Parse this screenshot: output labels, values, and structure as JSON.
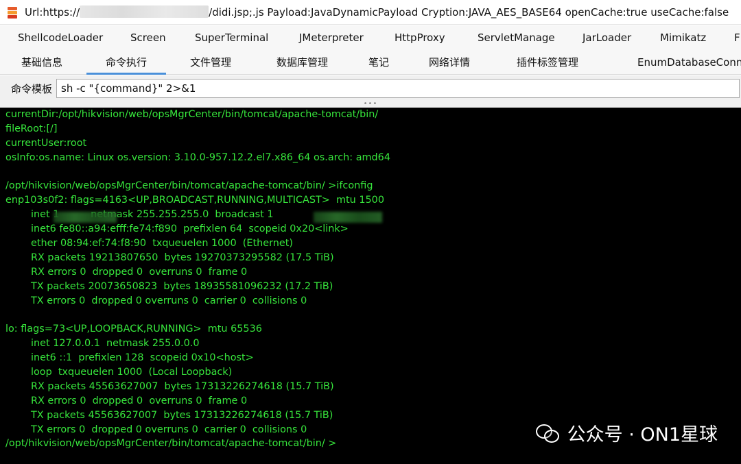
{
  "window": {
    "title_prefix": "Url:https://",
    "title_suffix": "/didi.jsp;.js Payload:JavaDynamicPayload Cryption:JAVA_AES_BASE64 openCache:true useCache:false"
  },
  "tabs_row1": [
    "ShellcodeLoader",
    "Screen",
    "SuperTerminal",
    "JMeterpreter",
    "HttpProxy",
    "ServletManage",
    "JarLoader",
    "Mimikatz",
    "F"
  ],
  "tabs_row2": [
    "基础信息",
    "命令执行",
    "文件管理",
    "数据库管理",
    "笔记",
    "网络详情",
    "插件标签管理",
    "EnumDatabaseConn"
  ],
  "active_tab": "命令执行",
  "command": {
    "label": "命令模板",
    "value": "sh -c \"{command}\" 2>&1"
  },
  "splitter_grip": "•••",
  "console": {
    "lines": [
      "currentDir:/opt/hikvision/web/opsMgrCenter/bin/tomcat/apache-tomcat/bin/",
      "fileRoot:[/]",
      "currentUser:root",
      "osInfo:os.name: Linux os.version: 3.10.0-957.12.2.el7.x86_64 os.arch: amd64",
      "",
      "/opt/hikvision/web/opsMgrCenter/bin/tomcat/apache-tomcat/bin/ >ifconfig",
      "enp103s0f2: flags=4163<UP,BROADCAST,RUNNING,MULTICAST>  mtu 1500",
      "inet 1          netmask 255.255.255.0  broadcast 1",
      "inet6 fe80::a94:efff:fe74:f890  prefixlen 64  scopeid 0x20<link>",
      "ether 08:94:ef:74:f8:90  txqueuelen 1000  (Ethernet)",
      "RX packets 19213807650  bytes 19270373295582 (17.5 TiB)",
      "RX errors 0  dropped 0  overruns 0  frame 0",
      "TX packets 20073650823  bytes 18935581096232 (17.2 TiB)",
      "TX errors 0  dropped 0 overruns 0  carrier 0  collisions 0",
      "",
      "lo: flags=73<UP,LOOPBACK,RUNNING>  mtu 65536",
      "inet 127.0.0.1  netmask 255.0.0.0",
      "inet6 ::1  prefixlen 128  scopeid 0x10<host>",
      "loop  txqueuelen 1000  (Local Loopback)",
      "RX packets 45563627007  bytes 17313226274618 (15.7 TiB)",
      "RX errors 0  dropped 0  overruns 0  frame 0",
      "TX packets 45563627007  bytes 17313226274618 (15.7 TiB)",
      "TX errors 0  dropped 0 overruns 0  carrier 0  collisions 0",
      "/opt/hikvision/web/opsMgrCenter/bin/tomcat/apache-tomcat/bin/ >"
    ]
  },
  "watermark": {
    "text": "公众号 · ON1星球"
  },
  "colors": {
    "console_bg": "#000000",
    "console_text": "#37e63c",
    "tab_accent": "#4a90d9"
  }
}
